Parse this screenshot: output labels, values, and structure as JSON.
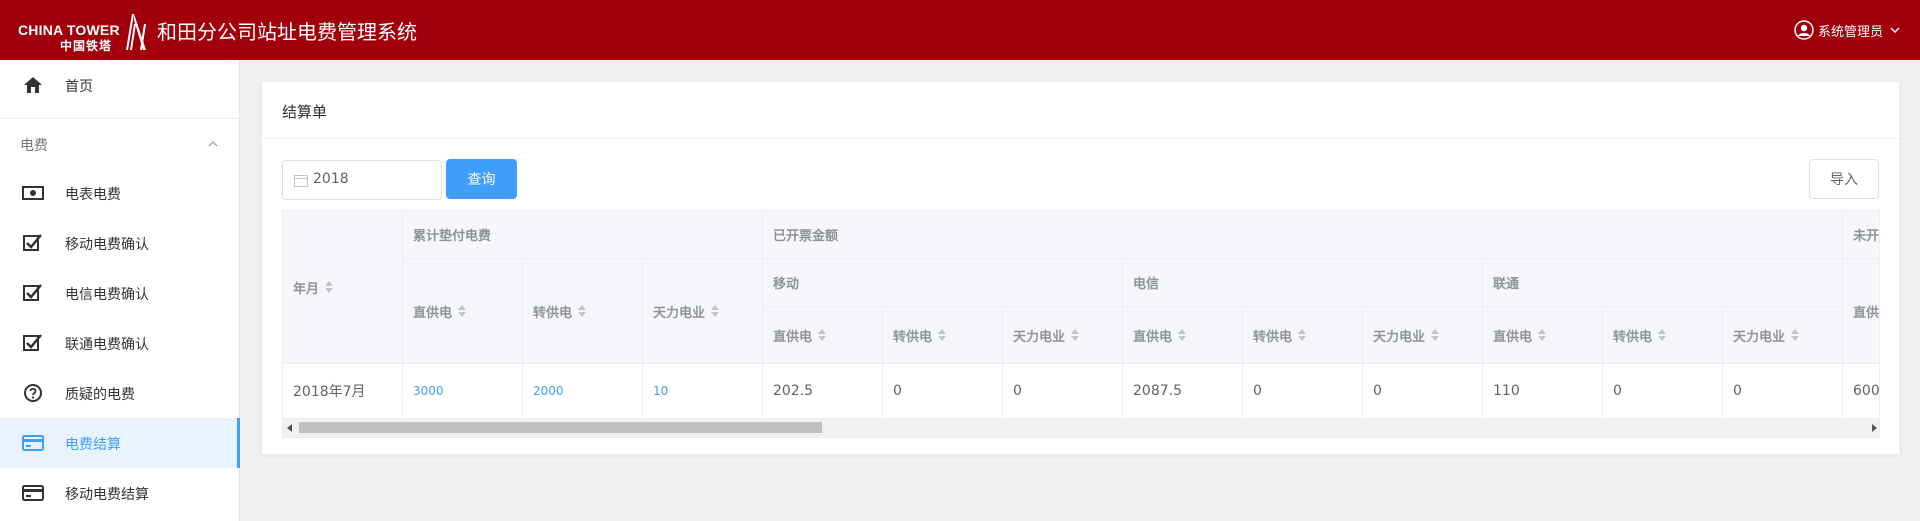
{
  "header": {
    "logo_en": "CHINA TOWER",
    "logo_cn": "中国铁塔",
    "app_title": "和田分公司站址电费管理系统",
    "user_name": "系统管理员",
    "bg_color": "#a1000b"
  },
  "sidebar": {
    "home": {
      "label": "首页",
      "icon": "home-icon"
    },
    "group": {
      "label": "电费",
      "icon": "chevron-up-icon"
    },
    "items": [
      {
        "label": "电表电费",
        "icon": "money-icon"
      },
      {
        "label": "移动电费确认",
        "icon": "checkbox-icon"
      },
      {
        "label": "电信电费确认",
        "icon": "checkbox-icon"
      },
      {
        "label": "联通电费确认",
        "icon": "checkbox-icon"
      },
      {
        "label": "质疑的电费",
        "icon": "question-icon"
      },
      {
        "label": "电费结算",
        "icon": "card-icon",
        "active": true
      },
      {
        "label": "移动电费结算",
        "icon": "card-icon"
      }
    ],
    "active_color": "#409eff"
  },
  "main": {
    "title": "结算单",
    "year_input": {
      "value": "2018"
    },
    "query_button": "查询",
    "import_button": "导入"
  },
  "table": {
    "col_month": "年月",
    "group_advance": "累计垫付电费",
    "group_invoiced": "已开票金额",
    "group_uninvoiced": "未开",
    "sub_mobile": "移动",
    "sub_telecom": "电信",
    "sub_unicom": "联通",
    "direct": "直供电",
    "transfer": "转供电",
    "tianli": "天力电业",
    "direct_partial": "直供",
    "row": {
      "month": "2018年7月",
      "adv_direct": "3000",
      "adv_transfer": "2000",
      "adv_tianli": "10",
      "mob_direct": "202.5",
      "mob_transfer": "0",
      "mob_tianli": "0",
      "tel_direct": "2087.5",
      "tel_transfer": "0",
      "tel_tianli": "0",
      "uni_direct": "110",
      "uni_transfer": "0",
      "uni_tianli": "0",
      "un_direct": "600"
    }
  }
}
